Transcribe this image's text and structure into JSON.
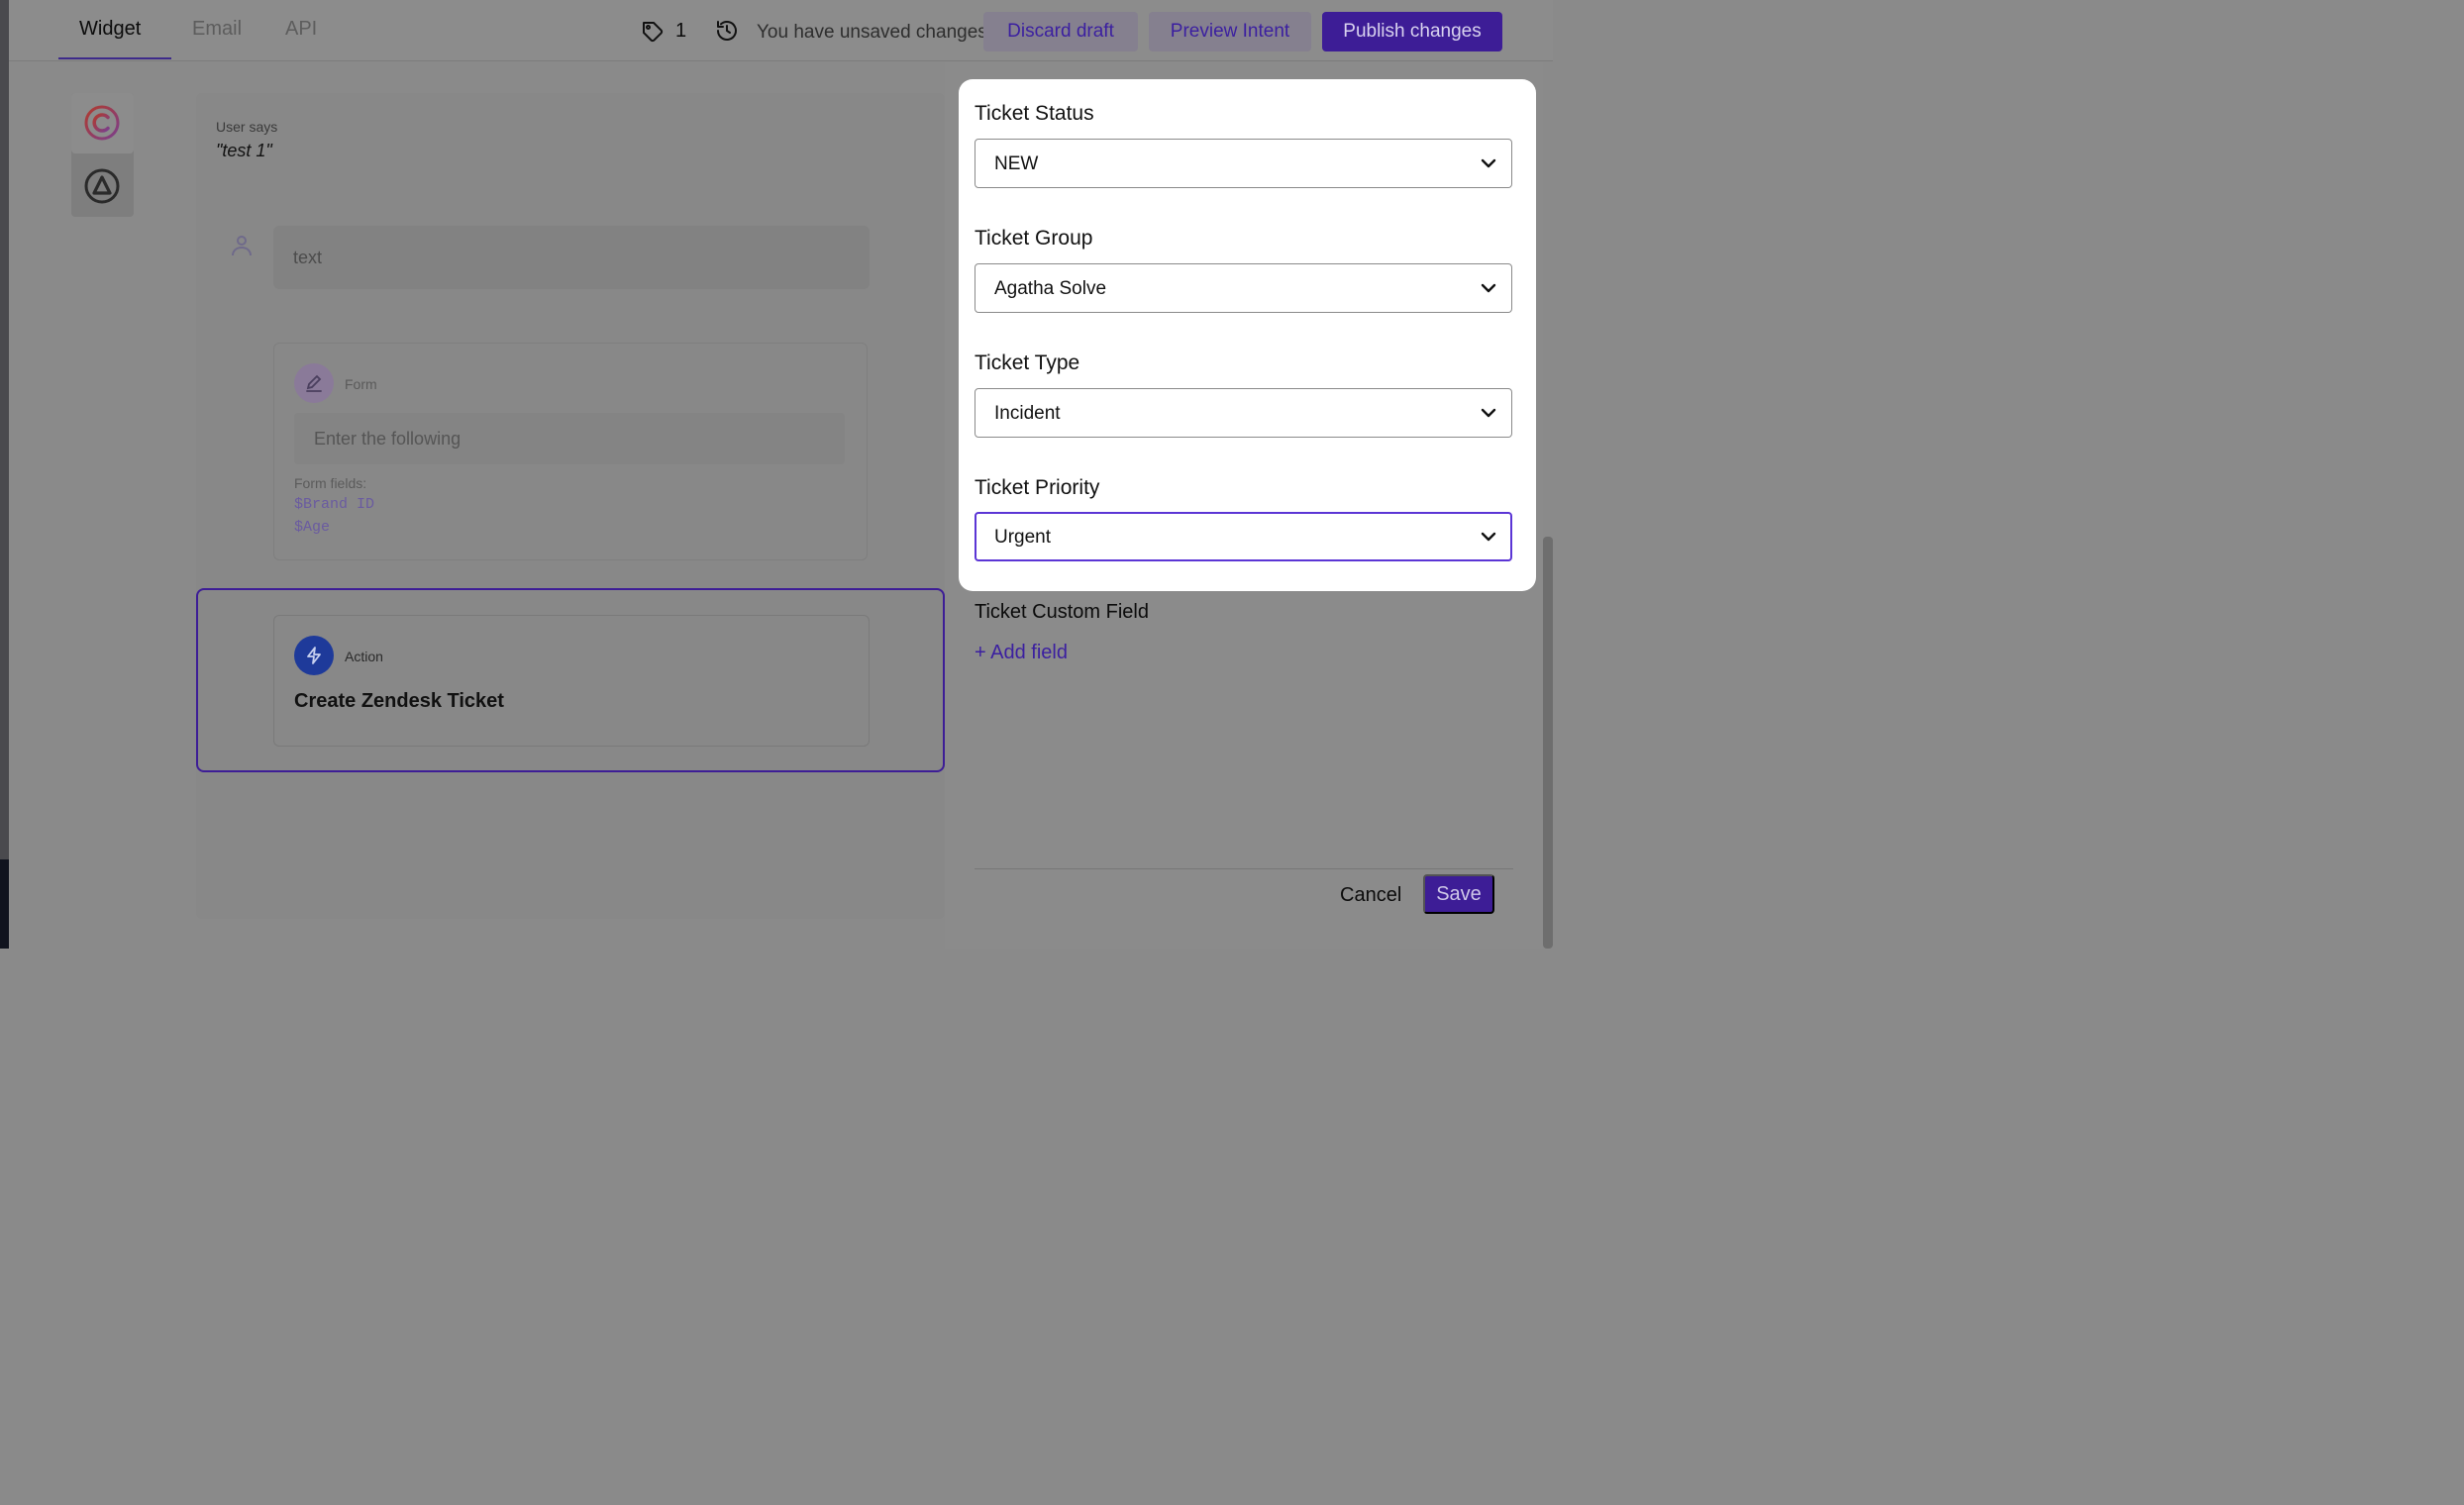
{
  "header": {
    "tabs": [
      {
        "label": "Widget",
        "active": true
      },
      {
        "label": "Email",
        "active": false
      },
      {
        "label": "API",
        "active": false
      }
    ],
    "tag_count": "1",
    "unsaved_text": "You have unsaved changes",
    "discard_label": "Discard draft",
    "preview_label": "Preview Intent",
    "publish_label": "Publish changes"
  },
  "sidebar": {
    "icons": [
      "brand-c-icon",
      "triangle-logo-icon"
    ]
  },
  "canvas": {
    "user_says_label": "User says",
    "user_says_text": "\"test 1\"",
    "text_bubble": "text",
    "form": {
      "label": "Form",
      "input_text": "Enter the following",
      "fields_label": "Form fields:",
      "fields": [
        "$Brand ID",
        "$Age"
      ]
    },
    "action": {
      "label": "Action",
      "title": "Create Zendesk Ticket"
    }
  },
  "panel": {
    "fields": [
      {
        "label": "Ticket Status",
        "value": "NEW"
      },
      {
        "label": "Ticket Group",
        "value": "Agatha Solve"
      },
      {
        "label": "Ticket Type",
        "value": "Incident"
      },
      {
        "label": "Ticket Priority",
        "value": "Urgent"
      }
    ],
    "custom_field_label": "Ticket Custom Field",
    "add_field_label": "+ Add field",
    "cancel_label": "Cancel",
    "save_label": "Save"
  },
  "colors": {
    "accent": "#3d1d96",
    "focus": "#5b35d5",
    "overlay": "#8a8a8a"
  }
}
